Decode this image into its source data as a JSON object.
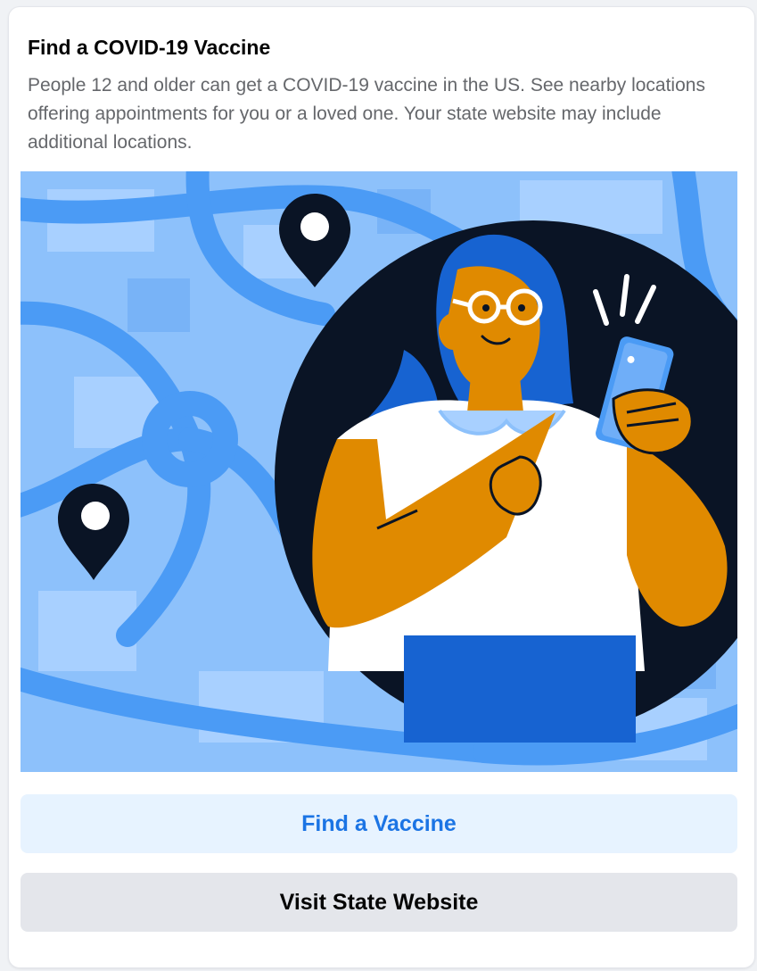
{
  "card": {
    "title": "Find a COVID-19 Vaccine",
    "description": "People 12 and older can get a COVID-19 vaccine in the US. See nearby locations offering appointments for you or a loved one. Your state website may include additional locations."
  },
  "illustration": {
    "subject": "person-pointing-at-phone-with-map-pins",
    "pins": [
      "map-pin-icon",
      "map-pin-icon"
    ]
  },
  "actions": {
    "find_vaccine_label": "Find a Vaccine",
    "visit_state_label": "Visit State Website"
  },
  "colors": {
    "primary_text": "#1b74e4",
    "primary_bg": "#e7f3ff",
    "secondary_bg": "#e4e6eb",
    "map_light": "#8dc1fb",
    "map_road": "#4b9bf5",
    "circle_dark": "#0a1425",
    "skin": "#e08a00"
  }
}
